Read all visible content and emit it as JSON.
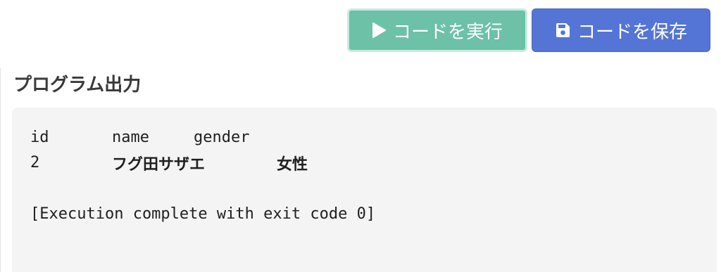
{
  "toolbar": {
    "run_label": "コードを実行",
    "save_label": "コードを保存",
    "run_icon": "play-icon",
    "save_icon": "floppy-disk-icon",
    "run_color": "#6cc1a6",
    "save_color": "#5475d6"
  },
  "output": {
    "title": "プログラム出力",
    "header": [
      "id",
      "name",
      "gender"
    ],
    "row": [
      "2",
      "フグ田サザエ",
      "女性"
    ],
    "exit_message": "[Execution complete with exit code 0]"
  }
}
